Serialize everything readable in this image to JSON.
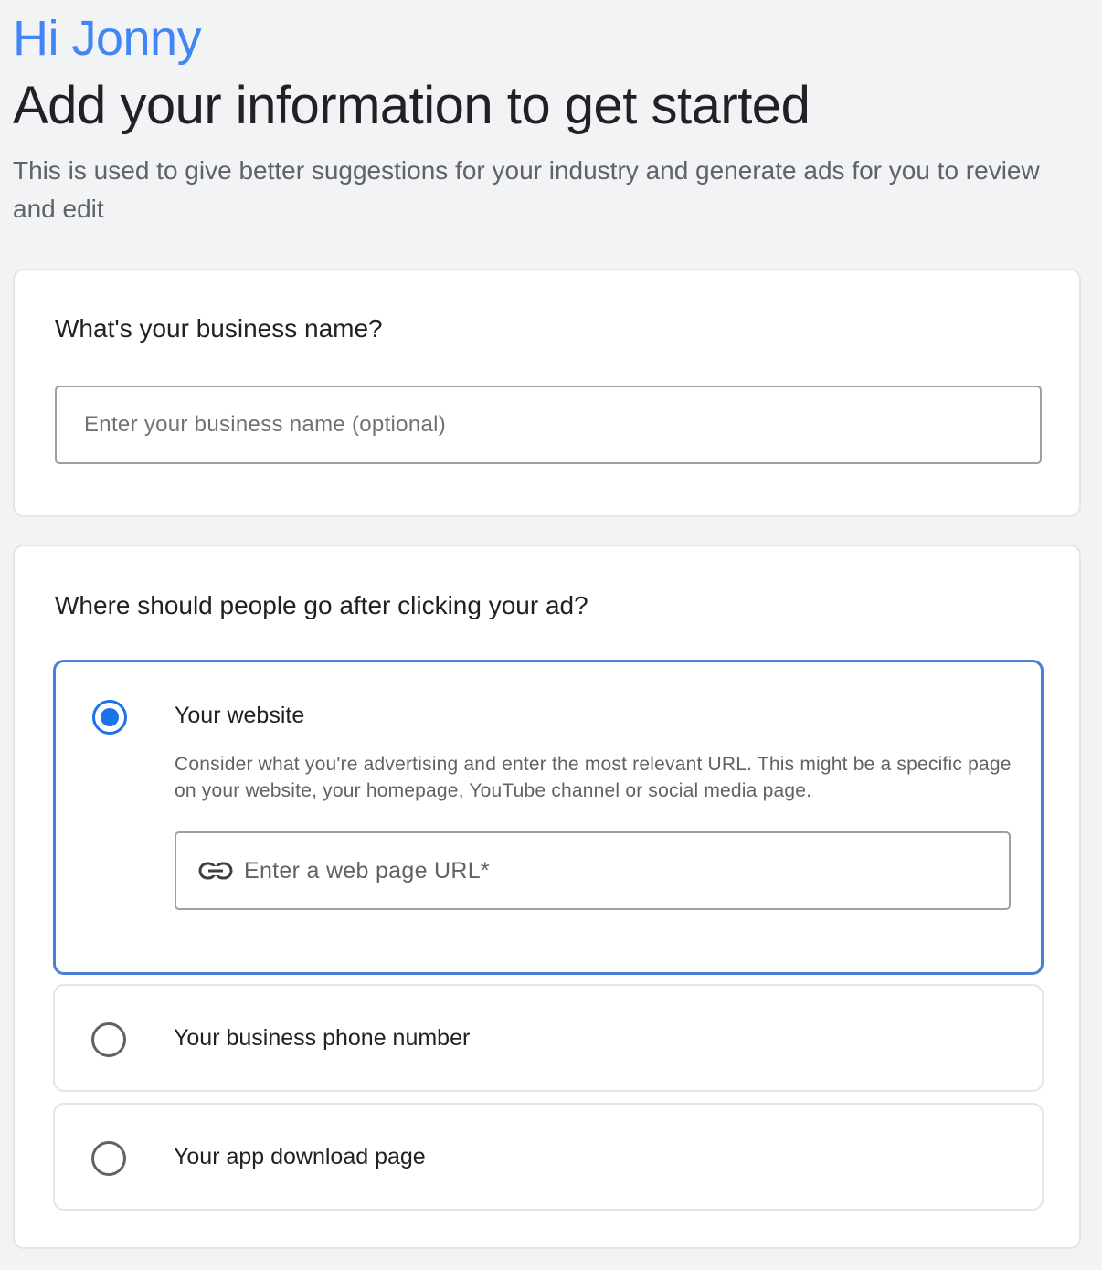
{
  "header": {
    "greeting": "Hi Jonny",
    "headline": "Add your information to get started",
    "subtitle": "This is used to give better suggestions for your industry and generate ads for you to review and edit"
  },
  "business_card": {
    "question": "What's your business name?",
    "input_placeholder": "Enter your business name (optional)",
    "input_value": ""
  },
  "destination_card": {
    "question": "Where should people go after clicking your ad?",
    "options": [
      {
        "label": "Your website",
        "selected": true,
        "description": "Consider what you're advertising and enter the most relevant URL. This might be a specific page on your website, your homepage, YouTube channel or social media page.",
        "url_placeholder": "Enter a web page URL*",
        "url_value": "",
        "icon": "link-icon"
      },
      {
        "label": "Your business phone number",
        "selected": false
      },
      {
        "label": "Your app download page",
        "selected": false
      }
    ]
  },
  "colors": {
    "accent": "#1a73e8",
    "greeting": "#4285f4",
    "selected_border": "#4a7fd6",
    "background": "#f1f3f4"
  }
}
